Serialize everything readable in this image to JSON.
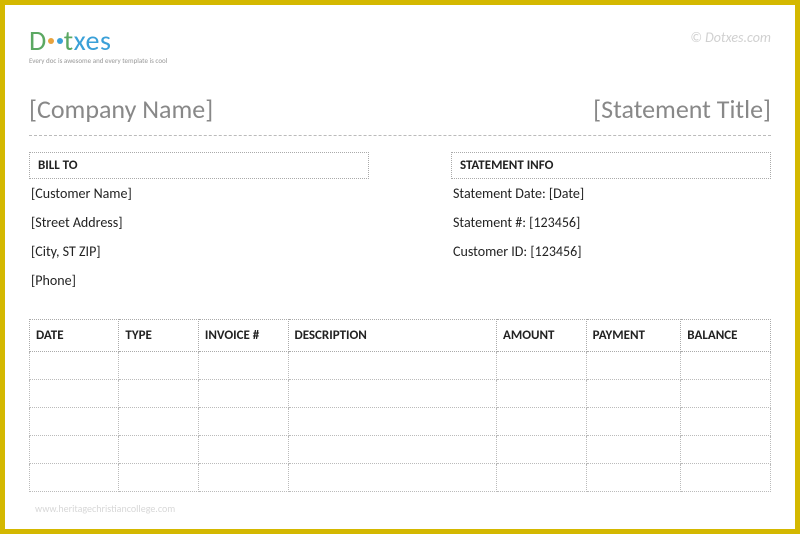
{
  "logo": {
    "part1": "D",
    "part2": "t",
    "part3": "xes",
    "tagline": "Every doc is awesome and every template is cool"
  },
  "watermark": "© Dotxes.com",
  "heading": {
    "company": "[Company Name]",
    "title": "[Statement Title]"
  },
  "bill_to": {
    "header": "BILL TO",
    "customer_name": "[Customer Name]",
    "street": "[Street Address]",
    "city": "[City, ST  ZIP]",
    "phone": "[Phone]"
  },
  "statement_info": {
    "header": "STATEMENT INFO",
    "date_label": "Statement Date: ",
    "date_value": "[Date]",
    "number_label": "Statement #: ",
    "number_value": "[123456]",
    "customer_label": "Customer ID: ",
    "customer_value": "[123456]"
  },
  "table": {
    "headers": {
      "date": "DATE",
      "type": "TYPE",
      "invoice": "INVOICE #",
      "description": "DESCRIPTION",
      "amount": "AMOUNT",
      "payment": "PAYMENT",
      "balance": "BALANCE"
    }
  },
  "footer_url": "www.heritagechristiancollege.com"
}
